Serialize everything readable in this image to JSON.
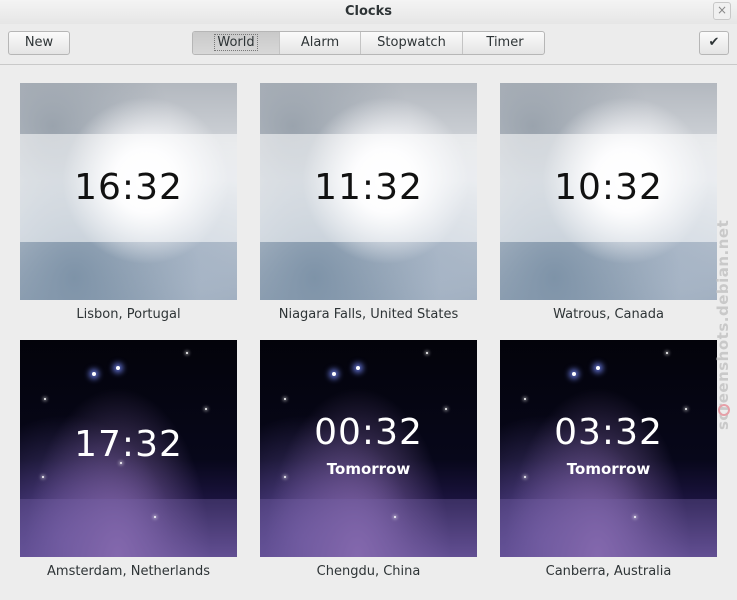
{
  "window": {
    "title": "Clocks",
    "close_glyph": "×"
  },
  "toolbar": {
    "new_label": "New",
    "done_glyph": "✔",
    "tabs": [
      {
        "label": "World",
        "active": true
      },
      {
        "label": "Alarm",
        "active": false
      },
      {
        "label": "Stopwatch",
        "active": false
      },
      {
        "label": "Timer",
        "active": false
      }
    ]
  },
  "clocks": [
    {
      "time": "16:32",
      "location": "Lisbon, Portugal",
      "theme": "day",
      "note": ""
    },
    {
      "time": "11:32",
      "location": "Niagara Falls, United States",
      "theme": "day",
      "note": ""
    },
    {
      "time": "10:32",
      "location": "Watrous, Canada",
      "theme": "day",
      "note": ""
    },
    {
      "time": "17:32",
      "location": "Amsterdam, Netherlands",
      "theme": "night",
      "note": ""
    },
    {
      "time": "00:32",
      "location": "Chengdu, China",
      "theme": "night",
      "note": "Tomorrow"
    },
    {
      "time": "03:32",
      "location": "Canberra, Australia",
      "theme": "night",
      "note": "Tomorrow"
    }
  ],
  "watermark": "screenshots.debian.net"
}
